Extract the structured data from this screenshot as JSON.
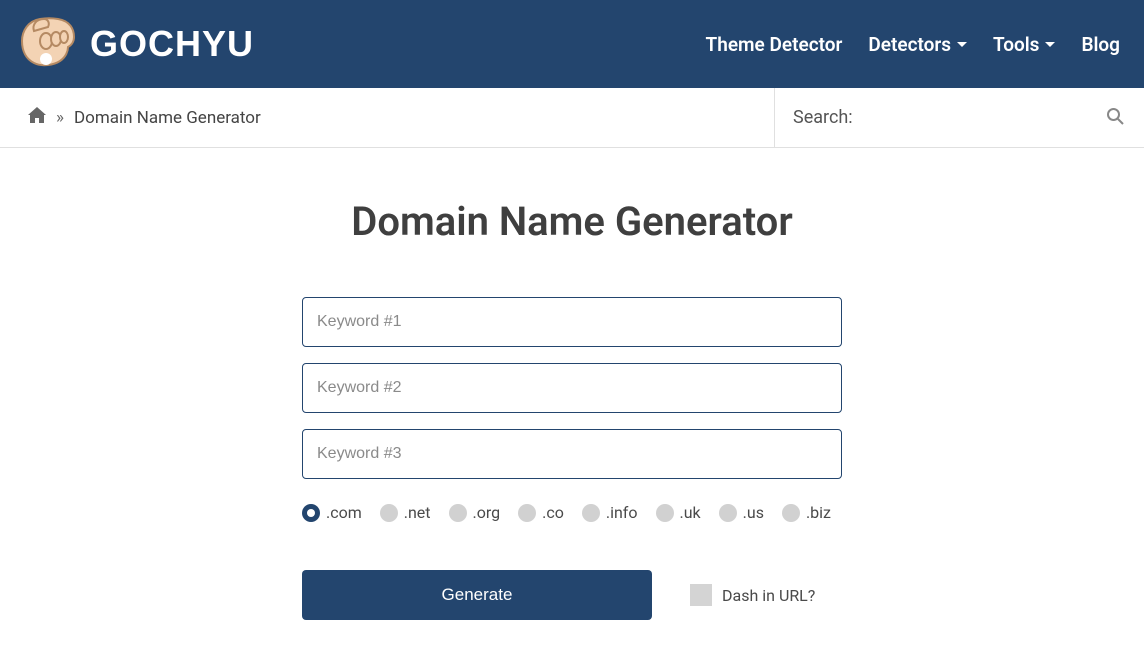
{
  "brand": "GOCHYU",
  "nav": {
    "theme_detector": "Theme Detector",
    "detectors": "Detectors",
    "tools": "Tools",
    "blog": "Blog"
  },
  "breadcrumb": {
    "separator": "»",
    "current": "Domain Name Generator"
  },
  "search": {
    "label": "Search:"
  },
  "page": {
    "title": "Domain Name Generator"
  },
  "form": {
    "keywords": [
      {
        "placeholder": "Keyword #1",
        "value": ""
      },
      {
        "placeholder": "Keyword #2",
        "value": ""
      },
      {
        "placeholder": "Keyword #3",
        "value": ""
      }
    ],
    "tlds": [
      {
        "label": ".com",
        "selected": true
      },
      {
        "label": ".net",
        "selected": false
      },
      {
        "label": ".org",
        "selected": false
      },
      {
        "label": ".co",
        "selected": false
      },
      {
        "label": ".info",
        "selected": false
      },
      {
        "label": ".uk",
        "selected": false
      },
      {
        "label": ".us",
        "selected": false
      },
      {
        "label": ".biz",
        "selected": false
      }
    ],
    "generate_label": "Generate",
    "dash_label": "Dash in URL?",
    "dash_checked": false
  }
}
